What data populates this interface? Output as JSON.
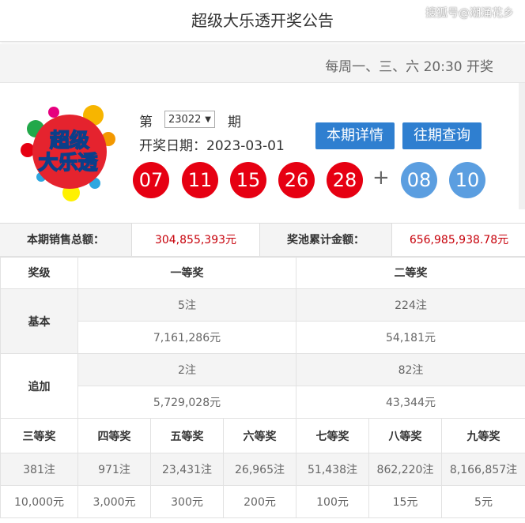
{
  "header": {
    "title": "超级大乐透开奖公告",
    "watermark": "搜狐号@潮涌花乡"
  },
  "schedule": "每周一、三、六 20:30 开奖",
  "logo": {
    "text_line1": "超级",
    "text_line2": "大乐透"
  },
  "draw": {
    "issue_prefix": "第",
    "issue": "23022",
    "issue_suffix": "期",
    "date_label": "开奖日期：",
    "date": "2023-03-01",
    "detail_button": "本期详情",
    "history_button": "往期查询",
    "red_balls": [
      "07",
      "11",
      "15",
      "26",
      "28"
    ],
    "plus": "+",
    "blue_balls": [
      "08",
      "10"
    ]
  },
  "sales": {
    "sales_label": "本期销售总额：",
    "sales_value": "304,855,393元",
    "pool_label": "奖池累计金额：",
    "pool_value": "656,985,938.78元"
  },
  "prize_table": {
    "level_header": "奖级",
    "first_header": "一等奖",
    "second_header": "二等奖",
    "basic_label": "基本",
    "basic_first_count": "5注",
    "basic_first_amount": "7,161,286元",
    "basic_second_count": "224注",
    "basic_second_amount": "54,181元",
    "extra_label": "追加",
    "extra_first_count": "2注",
    "extra_first_amount": "5,729,028元",
    "extra_second_count": "82注",
    "extra_second_amount": "43,344元"
  },
  "lower_prizes": [
    {
      "name": "三等奖",
      "count": "381注",
      "amount": "10,000元"
    },
    {
      "name": "四等奖",
      "count": "971注",
      "amount": "3,000元"
    },
    {
      "name": "五等奖",
      "count": "23,431注",
      "amount": "300元"
    },
    {
      "name": "六等奖",
      "count": "26,965注",
      "amount": "200元"
    },
    {
      "name": "七等奖",
      "count": "51,438注",
      "amount": "100元"
    },
    {
      "name": "八等奖",
      "count": "862,220注",
      "amount": "15元"
    },
    {
      "name": "九等奖",
      "count": "8,166,857注",
      "amount": "5元"
    }
  ],
  "colors": {
    "red_ball": "#e60012",
    "blue_ball": "#5b9ee0",
    "button": "#2f7fd0",
    "money": "#c7000a"
  }
}
